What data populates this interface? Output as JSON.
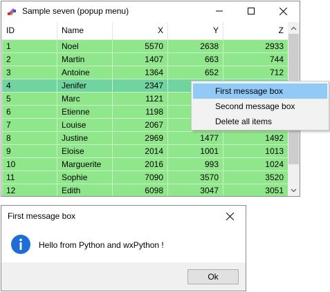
{
  "window": {
    "title": "Sample seven (popup menu)",
    "icon": "app-icon",
    "controls": [
      "minimize-icon",
      "maximize-icon",
      "close-icon"
    ]
  },
  "list": {
    "columns": [
      "ID",
      "Name",
      "X",
      "Y",
      "Z"
    ],
    "rows": [
      {
        "id": "1",
        "name": "Noel",
        "x": "5570",
        "y": "2638",
        "z": "2933"
      },
      {
        "id": "2",
        "name": "Martin",
        "x": "1407",
        "y": "663",
        "z": "744"
      },
      {
        "id": "3",
        "name": "Antoine",
        "x": "1364",
        "y": "652",
        "z": "712"
      },
      {
        "id": "4",
        "name": "Jenifer",
        "x": "2347",
        "y": "",
        "z": ""
      },
      {
        "id": "5",
        "name": "Marc",
        "x": "1121",
        "y": "",
        "z": ""
      },
      {
        "id": "6",
        "name": "Etienne",
        "x": "1198",
        "y": "",
        "z": ""
      },
      {
        "id": "7",
        "name": "Louise",
        "x": "2067",
        "y": "",
        "z": ""
      },
      {
        "id": "8",
        "name": "Justine",
        "x": "2969",
        "y": "1477",
        "z": "1492"
      },
      {
        "id": "9",
        "name": "Eloise",
        "x": "2014",
        "y": "1001",
        "z": "1013"
      },
      {
        "id": "10",
        "name": "Marguerite",
        "x": "2016",
        "y": "993",
        "z": "1024"
      },
      {
        "id": "11",
        "name": "Sophie",
        "x": "7090",
        "y": "3570",
        "z": "3520"
      },
      {
        "id": "12",
        "name": "Edith",
        "x": "6098",
        "y": "3047",
        "z": "3051"
      }
    ],
    "selected_row_index": 3,
    "row_color": "#90e68a",
    "selected_row_color": "#70d4a0"
  },
  "context_menu": {
    "items": [
      "First message box",
      "Second message box",
      "Delete all items"
    ],
    "highlighted_index": 0,
    "highlight_color": "#91c9f7"
  },
  "dialog": {
    "title": "First message box",
    "message": "Hello from Python and wxPython !",
    "icon": "info-icon",
    "ok_label": "Ok"
  }
}
